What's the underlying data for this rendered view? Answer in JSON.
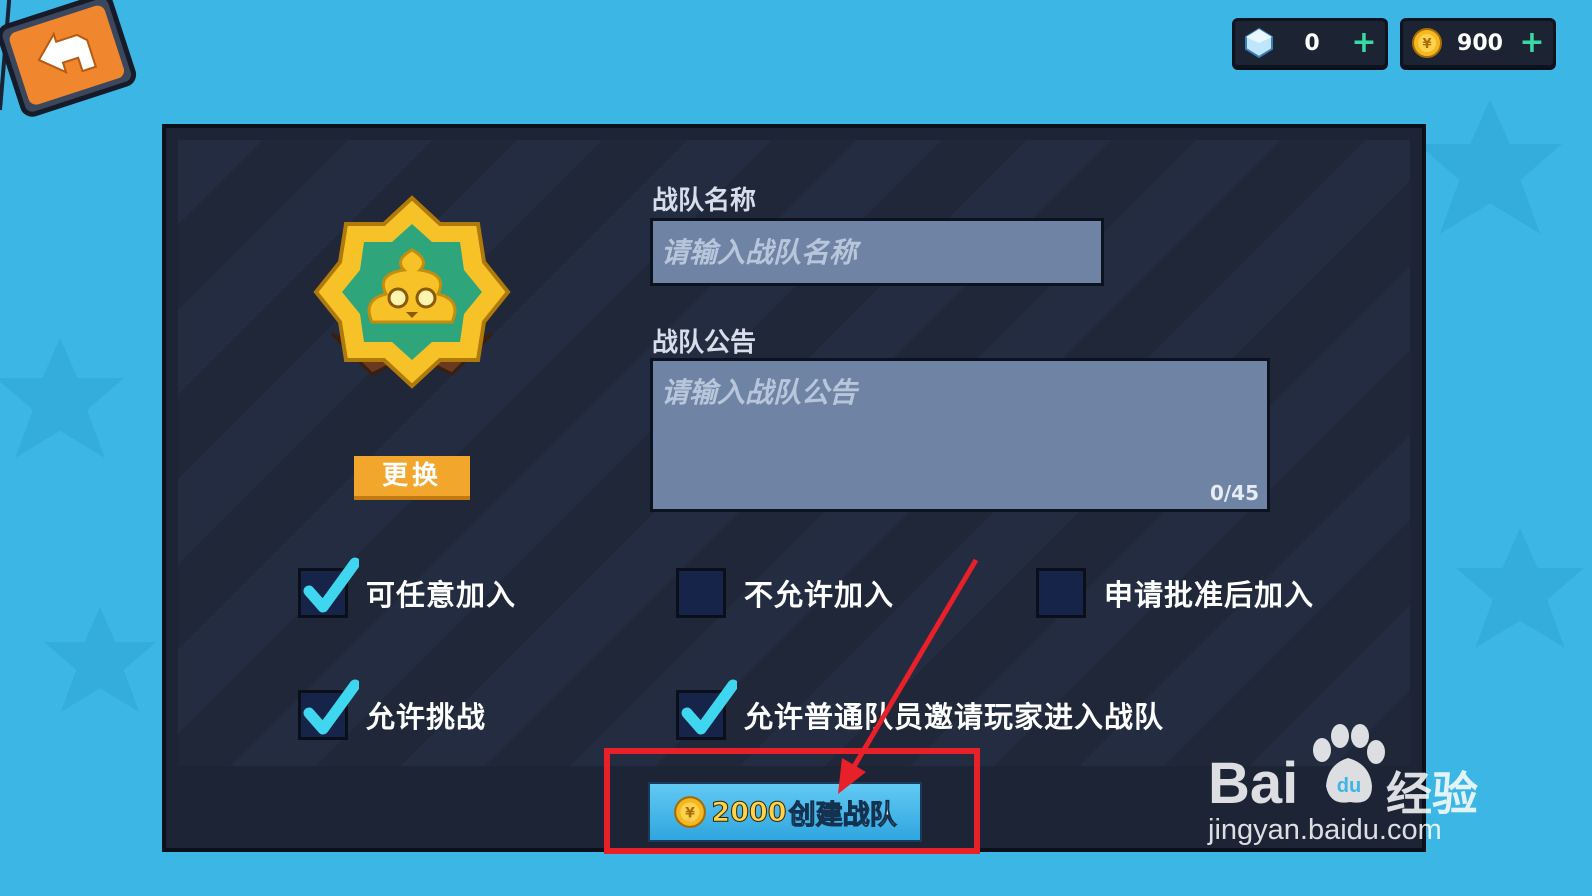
{
  "currencies": [
    {
      "icon": "gem-icon",
      "amount": "0",
      "plus": "+"
    },
    {
      "icon": "gold-coin-icon",
      "amount": "900",
      "plus": "+"
    }
  ],
  "form": {
    "name_label": "战队名称",
    "name_placeholder": "请输入战队名称",
    "notice_label": "战队公告",
    "notice_placeholder": "请输入战队公告",
    "notice_counter": "0/45"
  },
  "emblem": {
    "icon": "poop-emblem-icon",
    "change_label": "更换"
  },
  "join_options": [
    {
      "label": "可任意加入",
      "checked": true
    },
    {
      "label": "不允许加入",
      "checked": false
    },
    {
      "label": "申请批准后加入",
      "checked": false
    }
  ],
  "permissions": [
    {
      "label": "允许挑战",
      "checked": true
    },
    {
      "label": "允许普通队员邀请玩家进入战队",
      "checked": true
    }
  ],
  "create_button": {
    "price": "2000",
    "label": "创建战队",
    "icon": "gold-coin-icon"
  },
  "watermark": {
    "brand": "Bai",
    "brand_cn": "经验",
    "url": "jingyan.baidu.com"
  },
  "colors": {
    "background": "#3cb6e4",
    "panel": "#1c2436",
    "accent_orange": "#f2a62b",
    "check": "#3fd6f0",
    "annotation_red": "#e8202a"
  }
}
